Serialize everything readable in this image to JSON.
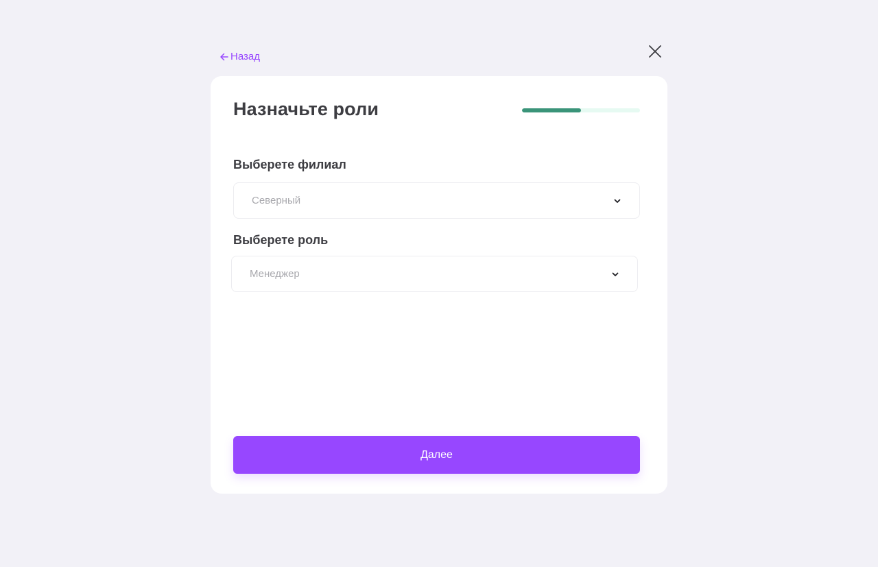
{
  "nav": {
    "back_label": "Назад"
  },
  "dialog": {
    "title": "Назначьте роли",
    "progress": 0.5,
    "branch": {
      "label": "Выберете филиал",
      "selected": "Северный"
    },
    "role": {
      "label": "Выберете роль",
      "selected": "Менеджер"
    },
    "next_label": "Далее"
  },
  "icons": {
    "back": "arrow-left-icon",
    "close": "close-icon",
    "dropdown": "chevron-down-icon"
  },
  "colors": {
    "accent": "#9747ff",
    "progress_fill": "#3a9479",
    "progress_track": "#e6faf2",
    "background": "#f2f1f7"
  }
}
